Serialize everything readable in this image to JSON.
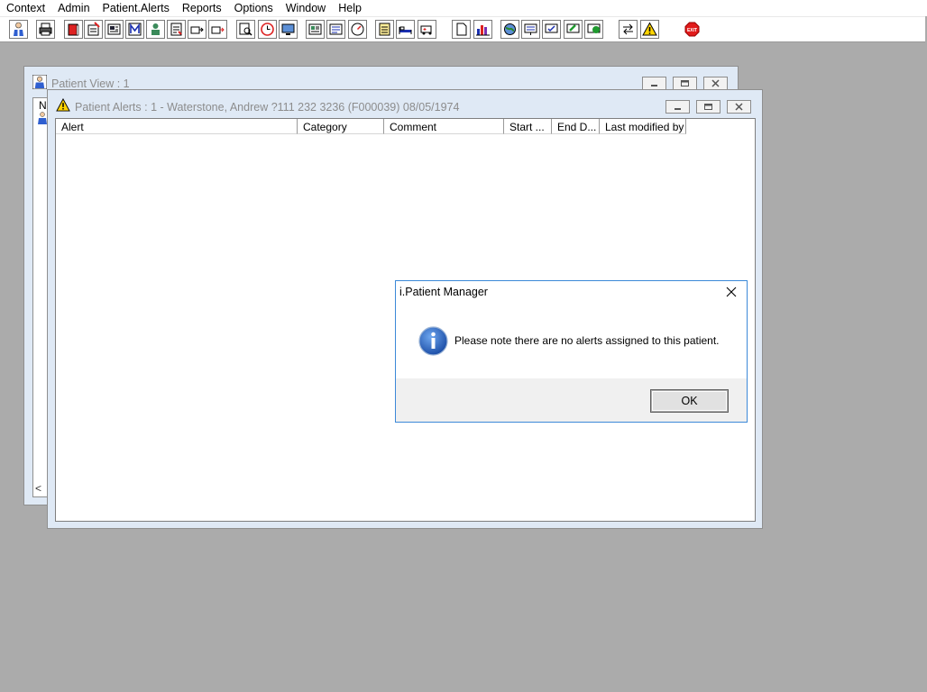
{
  "menu": [
    "Context",
    "Admin",
    "Patient.Alerts",
    "Reports",
    "Options",
    "Window",
    "Help"
  ],
  "toolbar": {
    "icons": [
      "patient-icon",
      "printer-icon",
      "book-icon",
      "notes-icon",
      "report-icon",
      "m-icon",
      "doctor-icon",
      "form-icon",
      "referral-icon",
      "referral-out-icon",
      "search-doc-icon",
      "clock-icon",
      "monitor-icon",
      "card-icon",
      "list-icon",
      "speedometer-icon",
      "notepad-icon",
      "bed-icon",
      "ambulance-icon",
      "document-icon",
      "barchart-icon",
      "globe-icon",
      "inbox-icon",
      "inbox-check-icon",
      "inbox-green-icon",
      "inbox-refresh-icon",
      "transfer-icon",
      "warning-icon",
      "exit-icon"
    ],
    "exit_label": "EXIT"
  },
  "patient_view": {
    "title": "Patient View : 1",
    "col_header": "N",
    "scroll_left": "<"
  },
  "patient_alerts": {
    "title": "Patient Alerts : 1 - Waterstone, Andrew ?111 232 3236 (F000039) 08/05/1974",
    "columns": [
      "Alert",
      "Category",
      "Comment",
      "Start ...",
      "End D...",
      "Last modified by"
    ]
  },
  "dialog": {
    "title": "i.Patient Manager",
    "message": "Please note there are no alerts assigned to this patient.",
    "ok_label": "OK"
  },
  "colors": {
    "desktop": "#ababab",
    "dialog_border": "#3c89d8",
    "info_icon": "#1d5fb8",
    "warning": "#ffd400",
    "exit": "#e11b1b"
  }
}
